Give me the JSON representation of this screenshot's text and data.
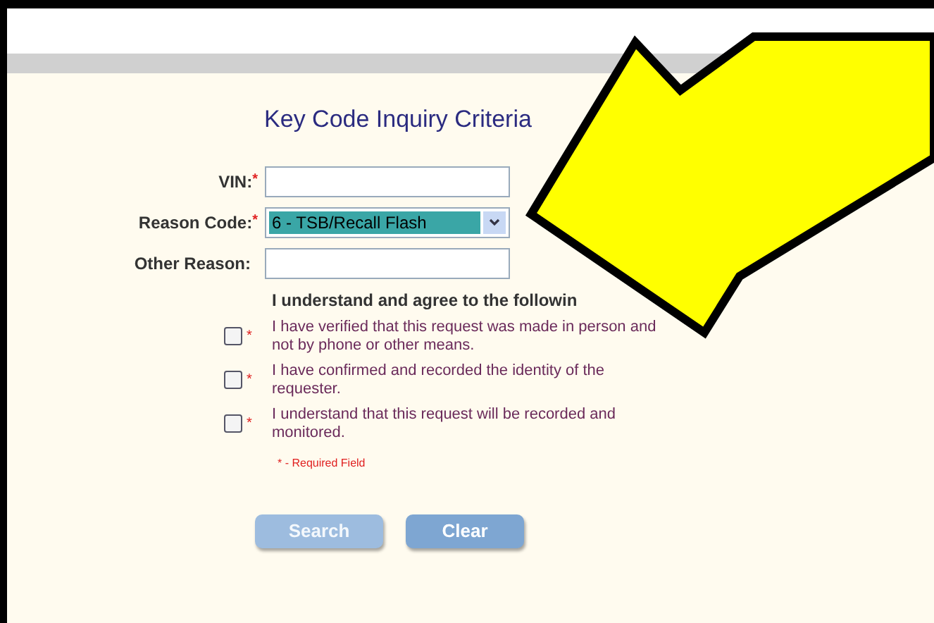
{
  "title": "Key Code Inquiry Criteria",
  "fields": [
    {
      "label": "VIN:",
      "required_mark": "*",
      "kind": "text"
    },
    {
      "label": "Reason Code:",
      "required_mark": "*",
      "kind": "select",
      "value": "6 - TSB/Recall Flash"
    },
    {
      "label": "Other Reason:",
      "kind": "text"
    }
  ],
  "agreement": {
    "heading": "I understand and agree to the followin",
    "items": [
      {
        "text": "I have verified that this request was made in person and not by phone or other means.",
        "checked": false,
        "required_mark": "*"
      },
      {
        "text": "I have confirmed and recorded the identity of the requester.",
        "checked": false,
        "required_mark": "*"
      },
      {
        "text": "I understand that this request will be recorded and monitored.",
        "checked": false,
        "required_mark": "*"
      }
    ]
  },
  "required_note": "* - Required Field",
  "buttons": [
    {
      "label": "Search",
      "disabled": true
    },
    {
      "label": "Clear",
      "disabled": false
    }
  ]
}
